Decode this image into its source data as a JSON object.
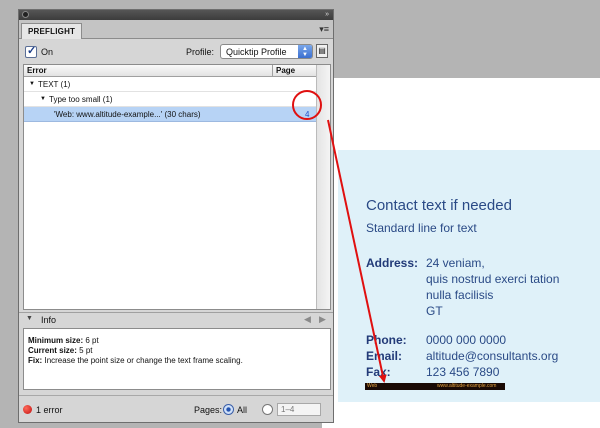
{
  "panel": {
    "tab_title": "PREFLIGHT",
    "menu_icon": "panel-menu-icon",
    "on_label": "On",
    "on_checked": true,
    "profile_label": "Profile:",
    "profile_value": "Quicktip Profile",
    "columns": {
      "error": "Error",
      "page": "Page"
    },
    "tree": [
      {
        "label": "TEXT (1)",
        "level": 0
      },
      {
        "label": "Type too small (1)",
        "level": 1
      },
      {
        "label": "'Web: www.altitude-example...' (30 chars)",
        "level": 2,
        "page": "4",
        "selected": true
      }
    ],
    "info_label": "Info",
    "info": {
      "min_label": "Minimum size:",
      "min_value": "6 pt",
      "cur_label": "Current size:",
      "cur_value": "5 pt",
      "fix_label": "Fix:",
      "fix_value": "Increase the point size or change the text frame scaling."
    },
    "status": {
      "errors": "1 error",
      "pages_label": "Pages:",
      "all_label": "All",
      "range_value": "1–4"
    }
  },
  "document": {
    "headline": "Contact text if needed",
    "subline": "Standard line for text",
    "address_label": "Address:",
    "address_lines": [
      "24 veniam,",
      "quis nostrud exerci tation",
      "nulla facilisis",
      "GT"
    ],
    "phone_label": "Phone:",
    "phone_value": "0000 000 0000",
    "email_label": "Email:",
    "email_value": "altitude@consultants.org",
    "fax_label": "Fax:",
    "fax_value": "123 456 7890",
    "web_label": "Web",
    "web_value": "www.altitude-example.com"
  },
  "colors": {
    "annotation": "#e01010",
    "doc_text": "#2a4a86",
    "doc_background": "#dff1f9",
    "selection": "#b7d3f5"
  }
}
